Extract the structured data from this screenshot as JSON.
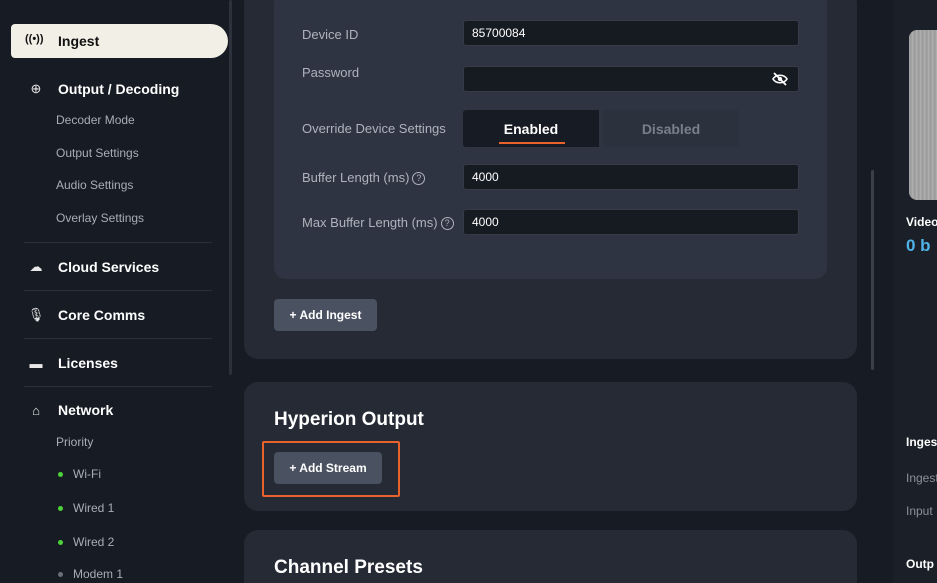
{
  "sidebar": {
    "ingest_label": "Ingest",
    "output_label": "Output / Decoding",
    "output_sub": [
      "Decoder Mode",
      "Output Settings",
      "Audio Settings",
      "Overlay Settings"
    ],
    "cloud_label": "Cloud Services",
    "core_label": "Core Comms",
    "licenses_label": "Licenses",
    "network_label": "Network",
    "network_priority": "Priority",
    "network_items": [
      "Wi-Fi",
      "Wired 1",
      "Wired 2",
      "Modem 1"
    ]
  },
  "ingest_form": {
    "device_id_label": "Device ID",
    "device_id_value": "85700084",
    "password_label": "Password",
    "password_value": "",
    "override_label": "Override Device Settings",
    "override_enabled": "Enabled",
    "override_disabled": "Disabled",
    "buffer_label": "Buffer Length (ms)",
    "buffer_value": "4000",
    "max_buffer_label": "Max Buffer Length (ms)",
    "max_buffer_value": "4000",
    "help_glyph": "?",
    "add_ingest": "+ Add Ingest"
  },
  "hyperion": {
    "title": "Hyperion Output",
    "add_stream": "+ Add Stream"
  },
  "channel_presets": {
    "title": "Channel Presets"
  },
  "right_panel": {
    "video_label": "Video",
    "video_rate": "0 b",
    "ingest_label": "Inges",
    "ingest_sub": "Ingest",
    "input_sub": "Input",
    "output_label": "Outp"
  },
  "colors": {
    "accent": "#e8622c",
    "status_green": "#4dd33a",
    "rate_blue": "#4fb3e8"
  }
}
